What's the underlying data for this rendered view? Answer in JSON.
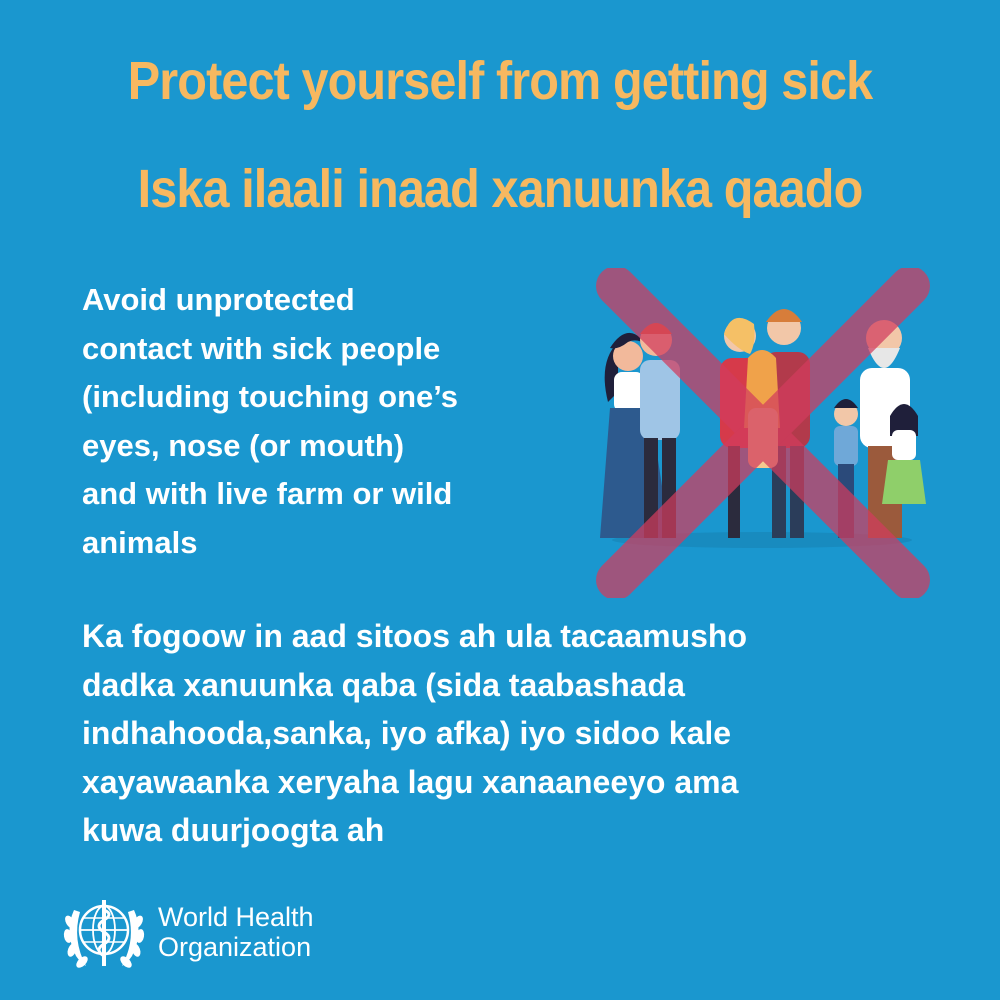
{
  "header": {
    "title_en": "Protect yourself from getting sick",
    "title_so": "Iska ilaali inaad xanuunka qaado"
  },
  "body": {
    "english_lines": [
      "Avoid unprotected",
      "contact with sick people",
      "(including touching one’s",
      "eyes, nose (or mouth)",
      "and with live farm or wild",
      "animals"
    ],
    "somali_lines": [
      "Ka fogoow in aad sitoos ah  ula tacaamusho",
      "dadka xanuunka qaba (sida taabashada",
      "indhahooda,sanka, iyo afka) iyo sidoo kale",
      "xayawaanka xeryaha lagu xanaaneeyo ama",
      "kuwa duurjoogta ah"
    ]
  },
  "illustration": {
    "icon": "crossed-out-family-icon",
    "cross_color": "#d23c5e"
  },
  "footer": {
    "org_line1": "World Health",
    "org_line2": "Organization",
    "emblem_icon": "who-emblem-icon"
  },
  "colors": {
    "background": "#1a97cf",
    "title": "#f7b860",
    "text": "#ffffff"
  }
}
